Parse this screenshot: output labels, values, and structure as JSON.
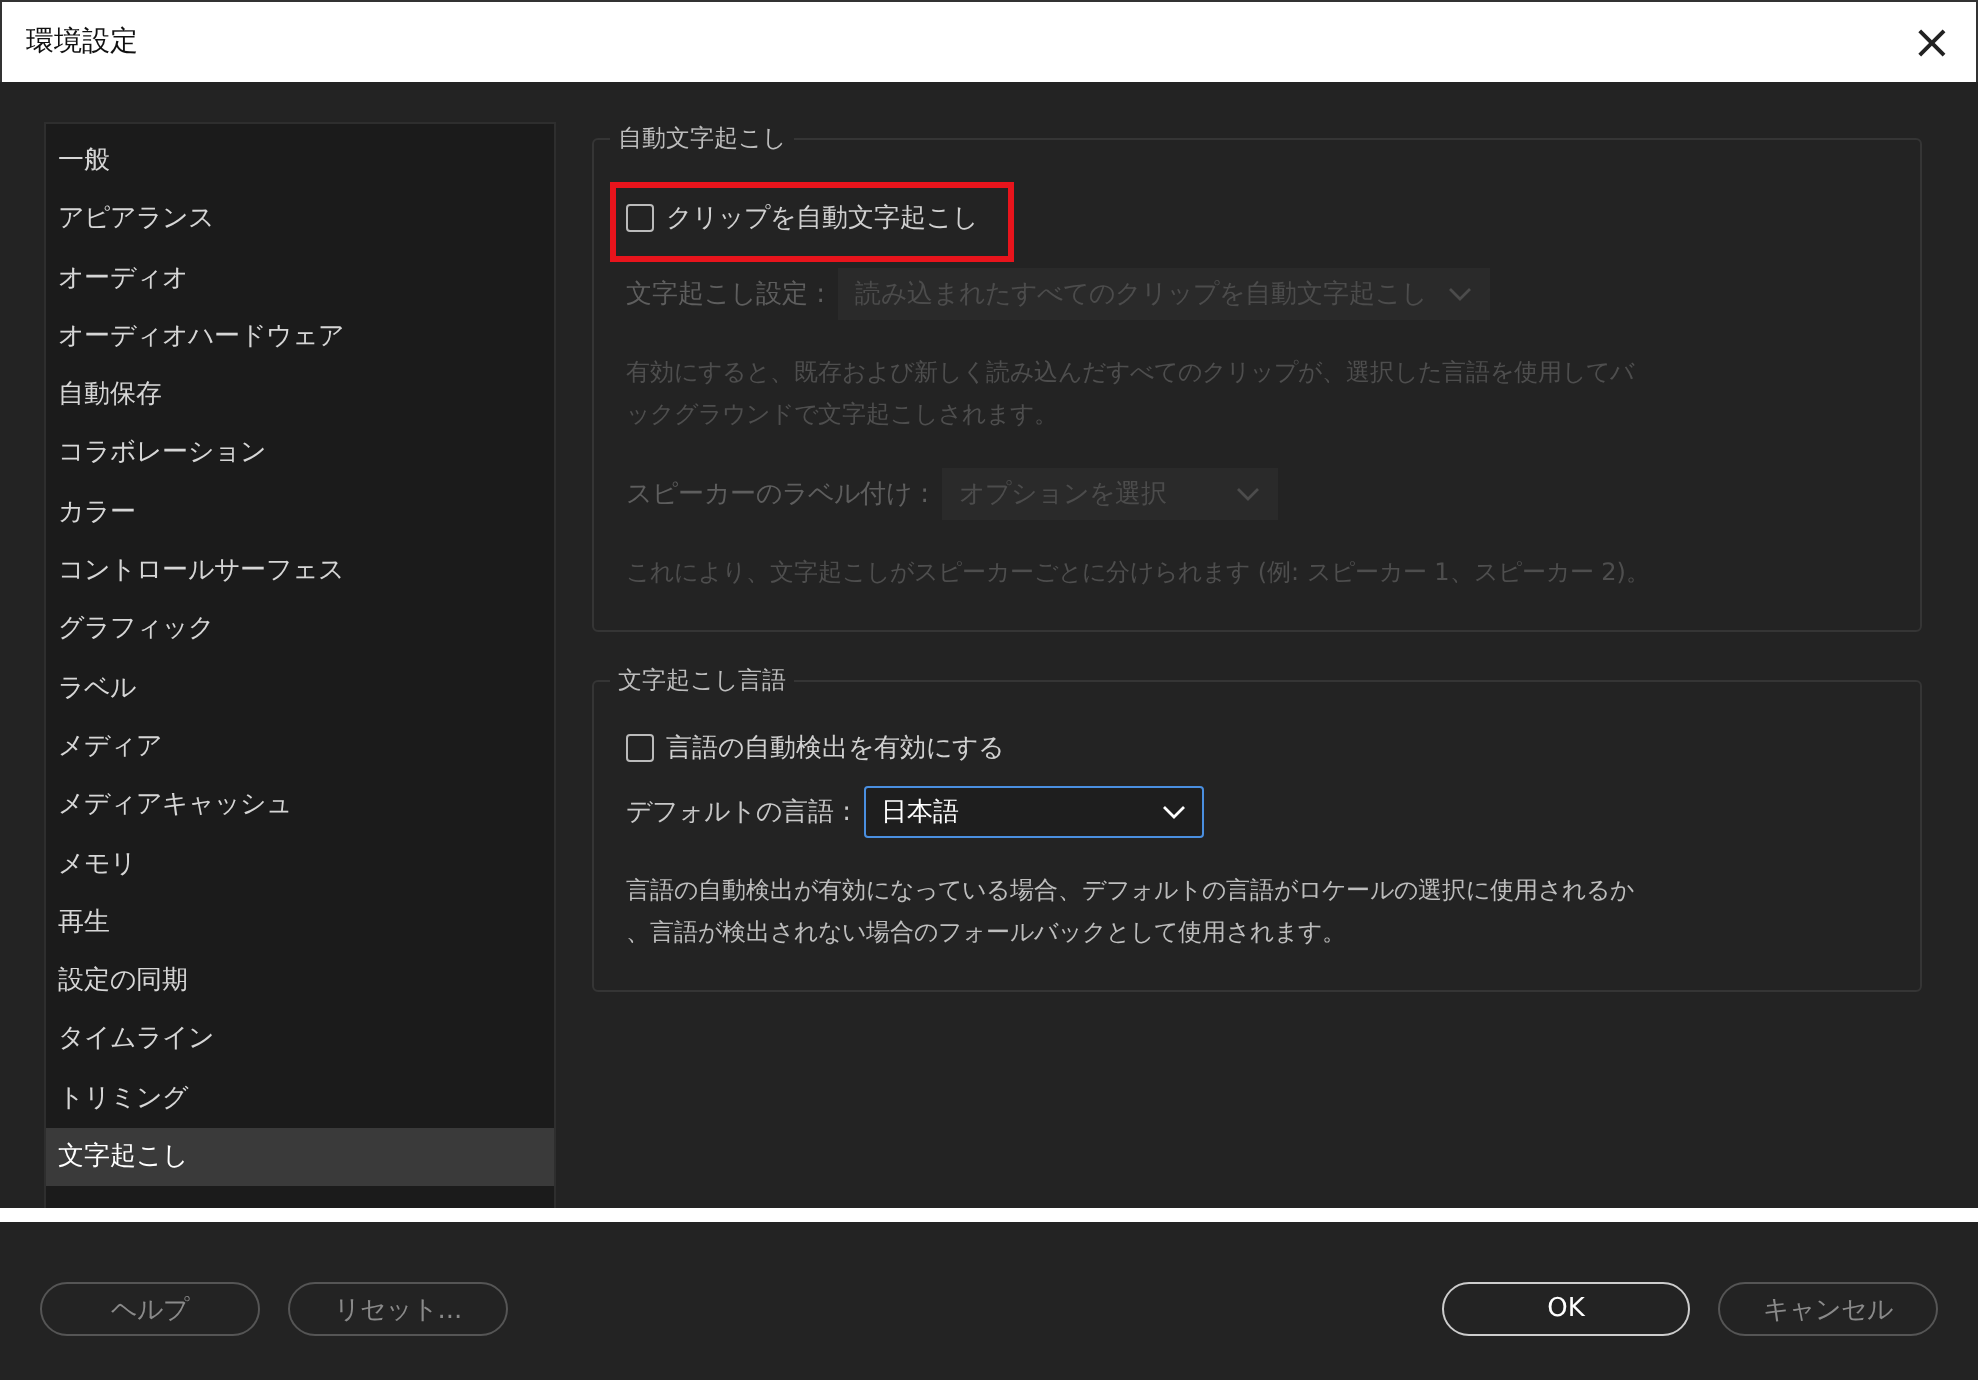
{
  "window": {
    "title": "環境設定",
    "close": "×"
  },
  "sidebar": {
    "items": [
      {
        "label": "一般",
        "selected": false
      },
      {
        "label": "アピアランス",
        "selected": false
      },
      {
        "label": "オーディオ",
        "selected": false
      },
      {
        "label": "オーディオハードウェア",
        "selected": false
      },
      {
        "label": "自動保存",
        "selected": false
      },
      {
        "label": "コラボレーション",
        "selected": false
      },
      {
        "label": "カラー",
        "selected": false
      },
      {
        "label": "コントロールサーフェス",
        "selected": false
      },
      {
        "label": "グラフィック",
        "selected": false
      },
      {
        "label": "ラベル",
        "selected": false
      },
      {
        "label": "メディア",
        "selected": false
      },
      {
        "label": "メディアキャッシュ",
        "selected": false
      },
      {
        "label": "メモリ",
        "selected": false
      },
      {
        "label": "再生",
        "selected": false
      },
      {
        "label": "設定の同期",
        "selected": false
      },
      {
        "label": "タイムライン",
        "selected": false
      },
      {
        "label": "トリミング",
        "selected": false
      },
      {
        "label": "文字起こし",
        "selected": true
      }
    ]
  },
  "groups": [
    {
      "title": "自動文字起こし",
      "rows": [
        {
          "kind": "checkbox",
          "label": "クリップを自動文字起こし",
          "checked": false,
          "disabled": false,
          "highlighted": true
        },
        {
          "kind": "select",
          "label": "文字起こし設定 :",
          "value": "読み込まれたすべてのクリップを自動文字起こし",
          "disabled": true,
          "focused": false
        },
        {
          "kind": "note",
          "text": "有効にすると、既存および新しく読み込んだすべてのクリップが、選択した言語を使用してバックグラウンドで文字起こしされます。",
          "disabled": true
        },
        {
          "kind": "select",
          "label": "スピーカーのラベル付け :",
          "value": "オプションを選択",
          "disabled": true,
          "focused": false
        },
        {
          "kind": "note",
          "text": "これにより、文字起こしがスピーカーごとに分けられます (例: スピーカー 1、スピーカー 2)。",
          "disabled": true
        }
      ]
    },
    {
      "title": "文字起こし言語",
      "rows": [
        {
          "kind": "checkbox",
          "label": "言語の自動検出を有効にする",
          "checked": false,
          "disabled": false,
          "highlighted": false
        },
        {
          "kind": "select",
          "label": "デフォルトの言語 :",
          "value": "日本語",
          "disabled": false,
          "focused": true
        },
        {
          "kind": "note",
          "text": "言語の自動検出が有効になっている場合、デフォルトの言語がロケールの選択に使用されるか、言語が検出されない場合のフォールバックとして使用されます。",
          "disabled": false
        }
      ]
    }
  ],
  "footer": {
    "left": [
      {
        "label": "ヘルプ",
        "primary": false
      },
      {
        "label": "リセット...",
        "primary": false
      }
    ],
    "right": [
      {
        "label": "OK",
        "primary": true
      },
      {
        "label": "キャンセル",
        "primary": false
      }
    ]
  }
}
